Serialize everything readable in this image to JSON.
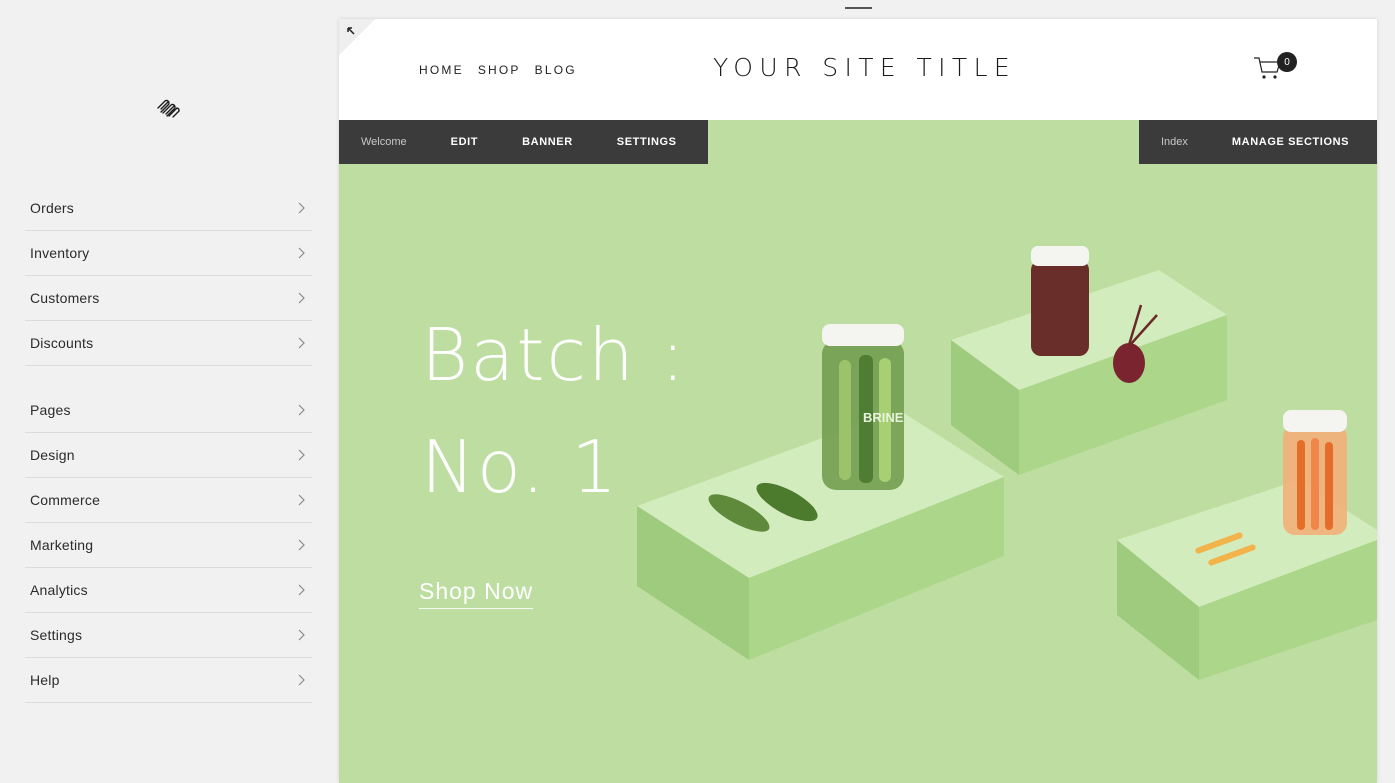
{
  "sidebar": {
    "primary": [
      {
        "label": "Orders"
      },
      {
        "label": "Inventory"
      },
      {
        "label": "Customers"
      },
      {
        "label": "Discounts"
      }
    ],
    "secondary": [
      {
        "label": "Pages"
      },
      {
        "label": "Design"
      },
      {
        "label": "Commerce"
      },
      {
        "label": "Marketing"
      },
      {
        "label": "Analytics"
      },
      {
        "label": "Settings"
      },
      {
        "label": "Help"
      }
    ]
  },
  "site": {
    "nav": [
      "HOME",
      "SHOP",
      "BLOG"
    ],
    "title": "YOUR SITE TITLE",
    "cart_count": "0"
  },
  "edit_bar": {
    "page_label": "Welcome",
    "edit": "EDIT",
    "banner": "BANNER",
    "settings": "SETTINGS",
    "index_label": "Index",
    "manage": "MANAGE SECTIONS"
  },
  "hero": {
    "line1": "Batch :",
    "line2": "No. 1",
    "cta": "Shop Now",
    "jar_label": "BRINE"
  },
  "colors": {
    "hero_bg": "#bddea0",
    "edit_bar": "#3b3b3b",
    "sidebar_bg": "#f1f1f1"
  }
}
